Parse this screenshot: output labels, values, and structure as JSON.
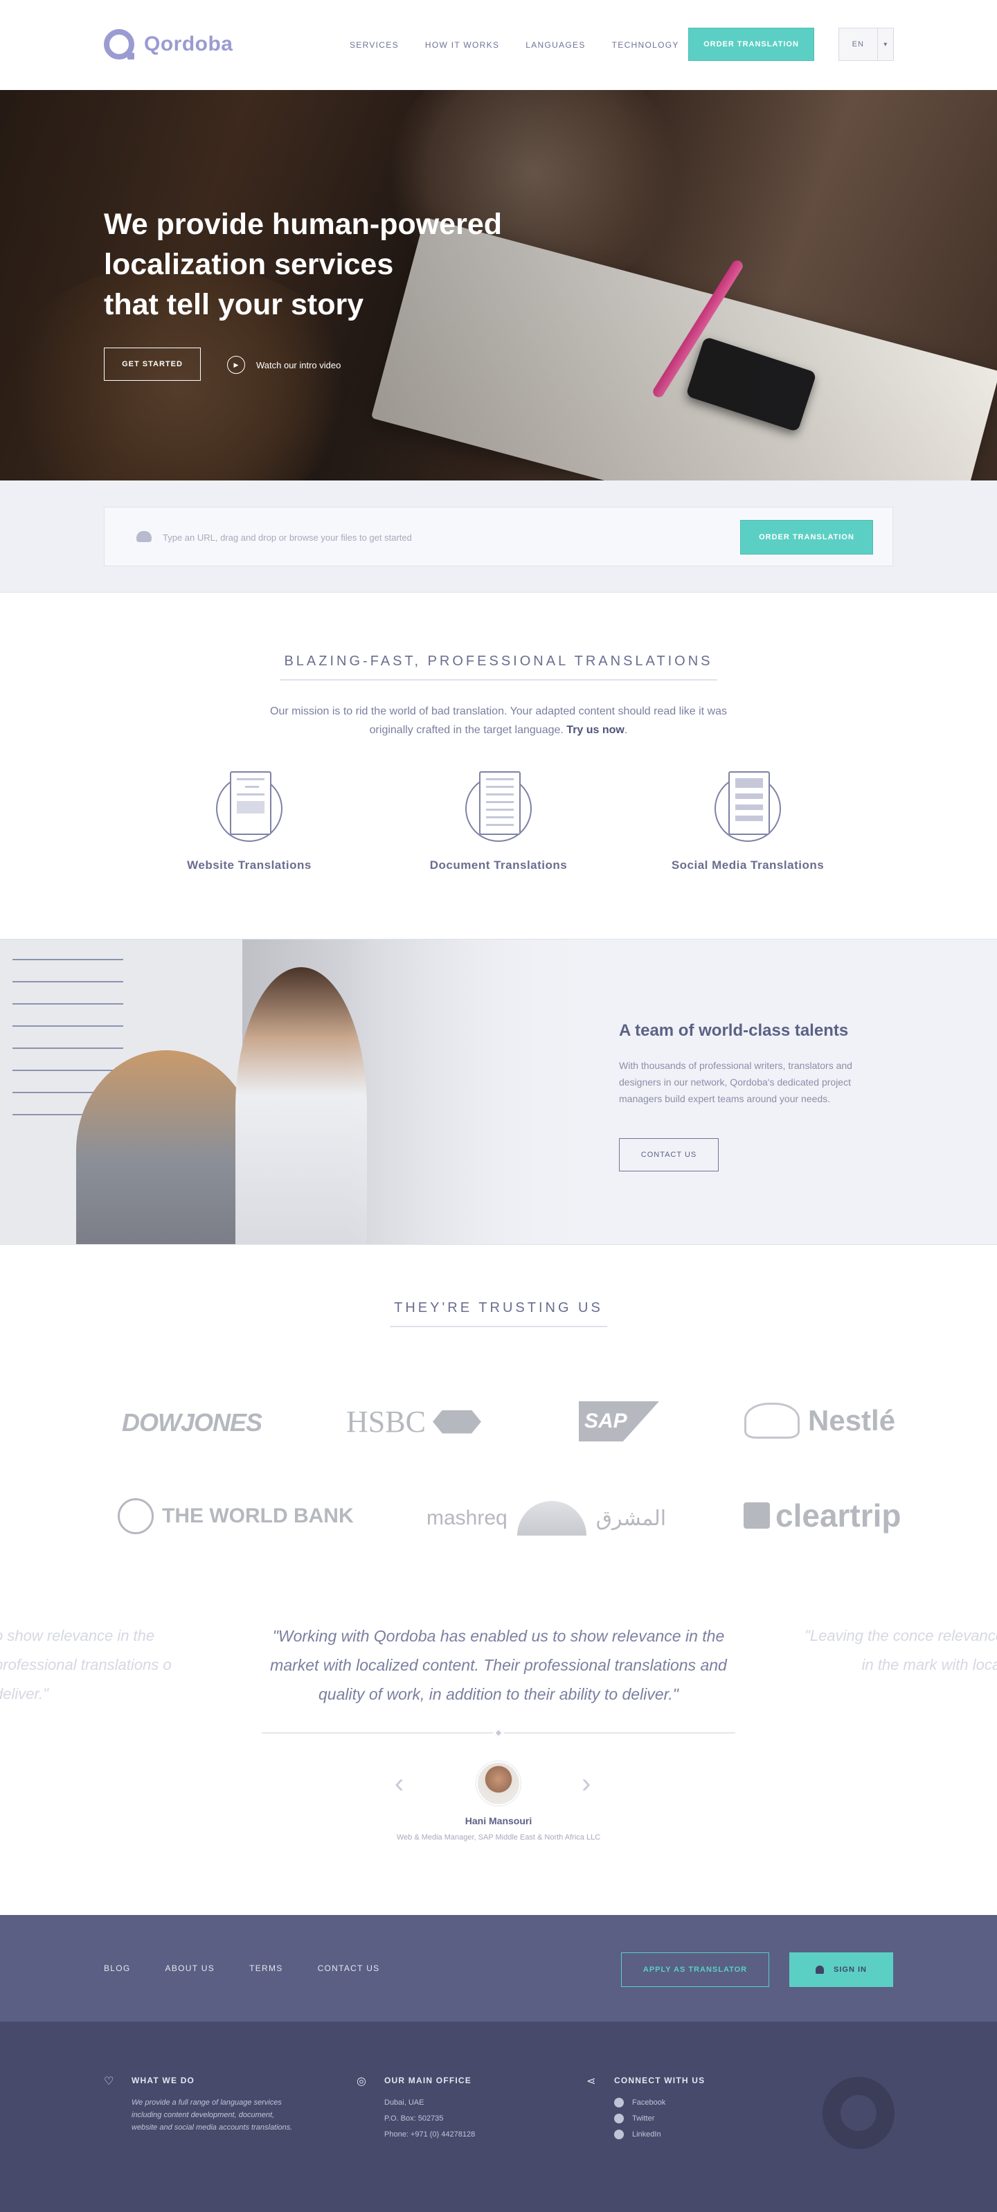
{
  "header": {
    "logo_text": "Qordoba",
    "nav": [
      "SERVICES",
      "HOW IT WORKS",
      "LANGUAGES",
      "TECHNOLOGY"
    ],
    "order_label": "ORDER TRANSLATION",
    "lang_code": "EN",
    "lang_caret": "▾"
  },
  "hero": {
    "title_lines": [
      "We provide human-powered",
      "localization services",
      "that tell your story"
    ],
    "cta_label": "GET STARTED",
    "video_label": "Watch our intro video"
  },
  "upload": {
    "text": "Type an URL, drag and drop or browse your files to get started",
    "button_label": "ORDER TRANSLATION"
  },
  "services": {
    "title": "BLAZING-FAST, PROFESSIONAL TRANSLATIONS",
    "mission": "Our mission is to rid the world of bad translation. Your adapted content should read like it was originally crafted in the target language.",
    "mission_link": "Try us now",
    "items": [
      {
        "label": "Website Translations",
        "icon": "website-icon"
      },
      {
        "label": "Document Translations",
        "icon": "document-icon"
      },
      {
        "label": "Social Media Translations",
        "icon": "tablet-icon"
      }
    ]
  },
  "team": {
    "title": "A team of world-class talents",
    "text": "With thousands of professional writers, translators and designers in our network, Qordoba's dedicated project managers build expert teams around your needs.",
    "button_label": "CONTACT US"
  },
  "trust": {
    "title": "THEY'RE TRUSTING US",
    "logos": {
      "dowjones": "DOWJONES",
      "hsbc": "HSBC",
      "sap": "SAP",
      "nestle": "Nestlé",
      "worldbank": "THE WORLD BANK",
      "mashreq": "mashreq",
      "mashreq_ar": "المشرق",
      "cleartrip": "cleartrip"
    },
    "quote_left": "o show relevance in the professional translations o deliver.\"",
    "quote": "\"Working with Qordoba has enabled us to show relevance in the market with localized content. Their professional translations and quality of work, in addition to their ability to deliver.\"",
    "quote_right": "\"Leaving the conce relevance in the mark with local",
    "author_name": "Hani Mansouri",
    "author_role": "Web & Media Manager, SAP Middle East & North Africa LLC"
  },
  "footer": {
    "links": [
      "BLOG",
      "ABOUT US",
      "TERMS",
      "CONTACT US"
    ],
    "apply_label": "APPLY AS TRANSLATOR",
    "signin_label": "SIGN IN",
    "what_title": "WHAT WE DO",
    "what_text": "We provide a full range of language services including content development, document, website and social media accounts translations.",
    "office_title": "OUR MAIN OFFICE",
    "office_lines": [
      "Dubai, UAE",
      "P.O. Box: 502735",
      "Phone: +971 (0) 44278128"
    ],
    "connect_title": "CONNECT WITH US",
    "social": [
      "Facebook",
      "Twitter",
      "LinkedIn"
    ]
  },
  "colors": {
    "accent": "#5ccfc4",
    "brand": "#9a9bd1",
    "footer_top": "#5a5f83",
    "footer_bottom": "#474a6b"
  }
}
